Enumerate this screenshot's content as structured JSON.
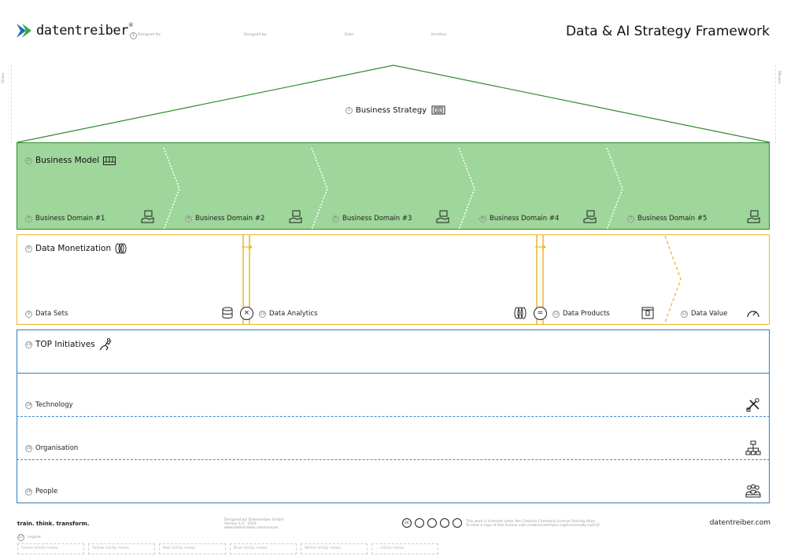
{
  "header": {
    "brand": "datentreiber",
    "trademark": "®",
    "title": "Data & AI Strategy Framework",
    "fields": [
      "Designed for:",
      "Designed by:",
      "Date:",
      "Iteration:"
    ]
  },
  "side": {
    "left": "Vision",
    "right": "Mission"
  },
  "strategy": {
    "num": "1",
    "label": "Business Strategy"
  },
  "business_model": {
    "num": "2",
    "label": "Business Model",
    "domains": [
      {
        "num": "3",
        "label": "Business Domain #1"
      },
      {
        "num": "4",
        "label": "Business Domain #2"
      },
      {
        "num": "5",
        "label": "Business Domain #3"
      },
      {
        "num": "6",
        "label": "Business Domain #4"
      },
      {
        "num": "7",
        "label": "Business Domain #5"
      }
    ]
  },
  "monetization": {
    "num": "8",
    "label": "Data Monetization",
    "items": [
      {
        "num": "9",
        "label": "Data Sets"
      },
      {
        "num": "10",
        "label": "Data Analytics"
      },
      {
        "num": "11",
        "label": "Data Products"
      },
      {
        "num": "12",
        "label": "Data Value"
      }
    ],
    "op_times": "×",
    "op_equals": "="
  },
  "initiatives": {
    "num": "13",
    "label": "TOP Initiatives",
    "rows": [
      {
        "num": "14",
        "label": "Technology"
      },
      {
        "num": "15",
        "label": "Organisation"
      },
      {
        "num": "16",
        "label": "People"
      }
    ]
  },
  "footer": {
    "tagline": "train. think. transform.",
    "credit_lines": [
      "Designed by: Datentreiber GmbH",
      "Version 1.0 · 2024",
      "www.datentreiber.com/canvas"
    ],
    "license_lines": [
      "This work is licensed under the Creative Commons License Sharing Alike.",
      "To view a copy of this license visit creativecommons.org/licenses/by-sa/4.0/"
    ],
    "url": "datentreiber.com",
    "legend_num": "17",
    "legend_label": "Legend:",
    "stickies": [
      "Green sticky notes",
      "Yellow sticky notes",
      "Red sticky notes",
      "Blue sticky notes",
      "White sticky notes",
      "... sticky notes"
    ]
  },
  "colors": {
    "green": "#2e8b2e",
    "green_fill": "#9ed69b",
    "yellow": "#e8b92a",
    "blue": "#2f7fc1"
  }
}
